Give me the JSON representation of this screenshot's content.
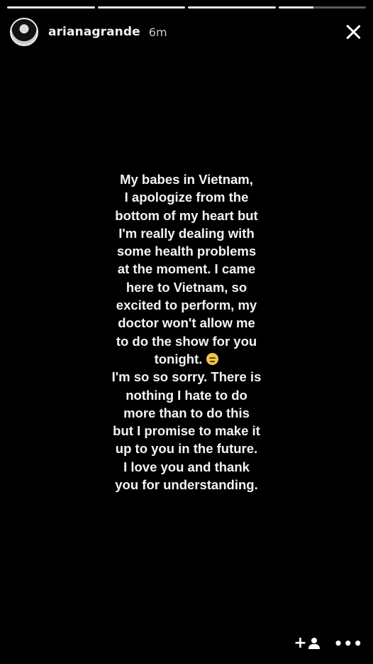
{
  "story": {
    "segments": [
      {
        "progress": 1.0
      },
      {
        "progress": 1.0
      },
      {
        "progress": 1.0
      },
      {
        "progress": 0.4
      }
    ],
    "username": "arianagrande",
    "time": "6m",
    "lines": [
      "My babes in Vietnam,",
      "I apologize from the",
      "bottom of my heart but",
      "I'm really dealing with",
      "some health problems",
      "at the moment. I came",
      "here to Vietnam, so",
      "excited to perform, my",
      "doctor won't allow me",
      "to do the show for you",
      "tonight.",
      "I'm so so sorry. There is",
      "nothing I hate to do",
      "more than to do this",
      "but I promise to make it",
      "up to you in the future.",
      "I love you and thank",
      "you for understanding."
    ],
    "emoji": "pensive-face-icon"
  },
  "actions": {
    "add_plus": "+",
    "more": "•••"
  },
  "colors": {
    "background": "#000000",
    "text": "#f4f4f4",
    "progress_track": "#5a5a5a",
    "progress_fill": "#e9e9e9"
  }
}
